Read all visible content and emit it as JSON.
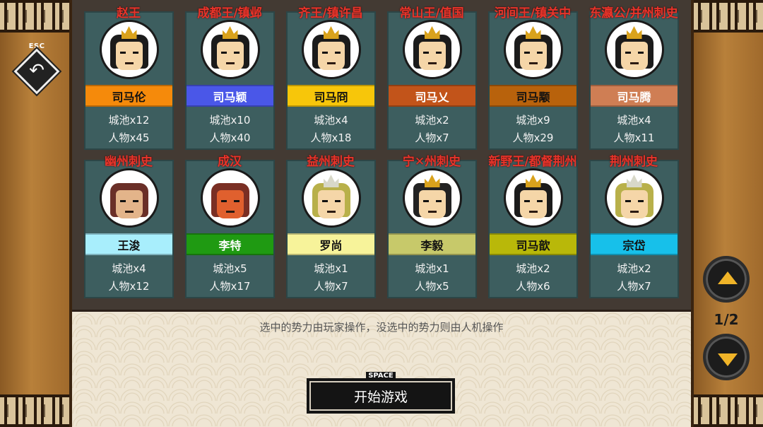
{
  "controls": {
    "esc_label": "ESC",
    "back_icon": "back-arrow-icon",
    "space_label": "SPACE",
    "start_button": "开始游戏",
    "hint": "选中的势力由玩家操作，没选中的势力则由人机操作",
    "page_indicator": "1/2"
  },
  "factions": [
    {
      "title": "赵王",
      "name": "司马伦",
      "cities": "城池x12",
      "people": "人物x45",
      "color": "#f58a0b"
    },
    {
      "title": "成都王/镇邺",
      "name": "司马颖",
      "cities": "城池x10",
      "people": "人物x40",
      "color": "#4a57e8"
    },
    {
      "title": "齐王/镇许昌",
      "name": "司马冏",
      "cities": "城池x4",
      "people": "人物x18",
      "color": "#f7c60a"
    },
    {
      "title": "常山王/值国",
      "name": "司马乂",
      "cities": "城池x2",
      "people": "人物x7",
      "color": "#c2541a"
    },
    {
      "title": "河间王/镇关中",
      "name": "司马颙",
      "cities": "城池x9",
      "people": "人物x29",
      "color": "#b8620c"
    },
    {
      "title": "东瀛公/并州刺史",
      "name": "司马腾",
      "cities": "城池x4",
      "people": "人物x11",
      "color": "#cf7e54"
    },
    {
      "title": "幽州刺史",
      "name": "王浚",
      "cities": "城池x4",
      "people": "人物x12",
      "color": "#a8eefc"
    },
    {
      "title": "成汉",
      "name": "李特",
      "cities": "城池x5",
      "people": "人物x17",
      "color": "#1f9a12"
    },
    {
      "title": "益州刺史",
      "name": "罗尚",
      "cities": "城池x1",
      "people": "人物x7",
      "color": "#f7f39a"
    },
    {
      "title_pre": "宁",
      "title_mark": "✕",
      "title_post": "州刺史",
      "name": "李毅",
      "cities": "城池x1",
      "people": "人物x5",
      "color": "#c7c96a"
    },
    {
      "title": "新野王/都督荆州",
      "name": "司马歆",
      "cities": "城池x2",
      "people": "人物x6",
      "color": "#b9b809"
    },
    {
      "title": "荆州刺史",
      "name": "宗岱",
      "cities": "城池x2",
      "people": "人物x7",
      "color": "#17c0ea"
    }
  ]
}
